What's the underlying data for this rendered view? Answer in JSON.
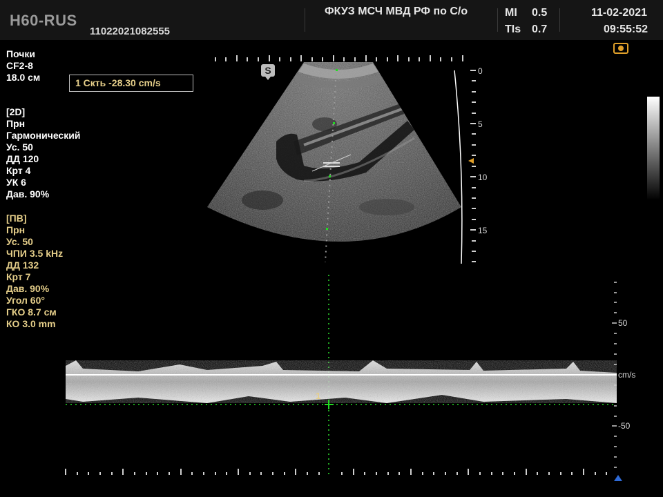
{
  "header": {
    "brand": "H60-RUS",
    "patient_id": "11022021082555",
    "institution": "ФКУЗ МСЧ МВД РФ по С/о",
    "mi_label": "MI",
    "mi_value": "0.5",
    "tis_label": "TIs",
    "tis_value": "0.7",
    "date": "11-02-2021",
    "time": "09:55:52"
  },
  "exam": {
    "preset": "Почки",
    "probe": "CF2-8",
    "depth": "18.0 см"
  },
  "measurement": {
    "label": "1  Скть  -28.30 cm/s"
  },
  "bmode": {
    "section": "[2D]",
    "items": [
      "Прн",
      "Гармонический",
      "Ус.  50",
      "ДД  120",
      "Крт 4",
      "УК  6",
      "Дав. 90%"
    ]
  },
  "pw": {
    "section": "[ПВ]",
    "items": [
      "Прн",
      "Ус.  50",
      "ЧПИ 3.5 kHz",
      "ДД  132",
      "Крт 7",
      "Дав. 90%",
      "Угол 60°",
      "ГКО 8.7 см",
      "КО  3.0 mm"
    ]
  },
  "depth_scale": {
    "labels": [
      "0",
      "5",
      "10",
      "15"
    ]
  },
  "spectrum_scale": {
    "top_label": "50",
    "unit_label": "cm/s",
    "bottom_label": "-50"
  },
  "cursor": {
    "marker_label": "1",
    "s_badge": "S"
  },
  "colors": {
    "accent_yellow": "#e6cf8a",
    "header_bg": "#151515",
    "camera_icon": "#e0a02a",
    "marker_blue": "#2f6bd8",
    "cursor_green": "#22dd22"
  }
}
